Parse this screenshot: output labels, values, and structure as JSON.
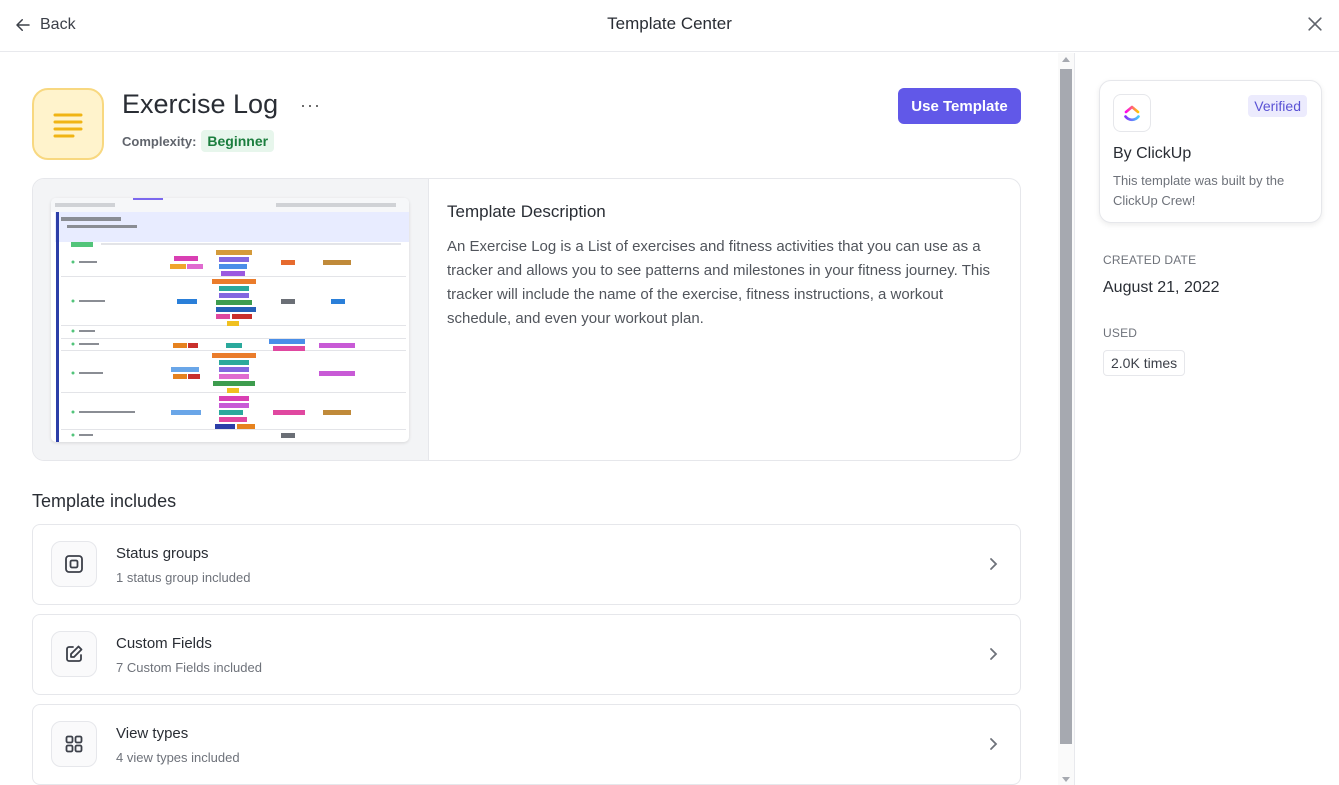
{
  "header": {
    "back_label": "Back",
    "title": "Template Center"
  },
  "template": {
    "name": "Exercise Log",
    "more_label": "···",
    "complexity_label": "Complexity:",
    "complexity_value": "Beginner",
    "use_button": "Use Template",
    "icon_color": "#f0b414"
  },
  "description": {
    "title": "Template Description",
    "text": "An Exercise Log is a List of exercises and fitness activities that you can use as a tracker and allows you to see patterns and milestones in your fitness journey. This tracker will include the name of the exercise, fitness instructions, a workout schedule, and even your workout plan."
  },
  "includes": {
    "title": "Template includes",
    "items": [
      {
        "title": "Status groups",
        "subtitle": "1 status group included",
        "icon": "square-target-icon"
      },
      {
        "title": "Custom Fields",
        "subtitle": "7 Custom Fields included",
        "icon": "edit-square-icon"
      },
      {
        "title": "View types",
        "subtitle": "4 view types included",
        "icon": "grid-icon"
      }
    ]
  },
  "sidebar": {
    "verified": "Verified",
    "by": "By ClickUp",
    "by_desc": "This template was built by the ClickUp Crew!",
    "created_label": "CREATED DATE",
    "created_value": "August 21, 2022",
    "used_label": "USED",
    "used_value": "2.0K times"
  },
  "colors": {
    "accent": "#6158e8",
    "beginner_bg": "#e7f6ec",
    "beginner_text": "#1b7e3e",
    "verified_bg": "#ecebfd"
  }
}
